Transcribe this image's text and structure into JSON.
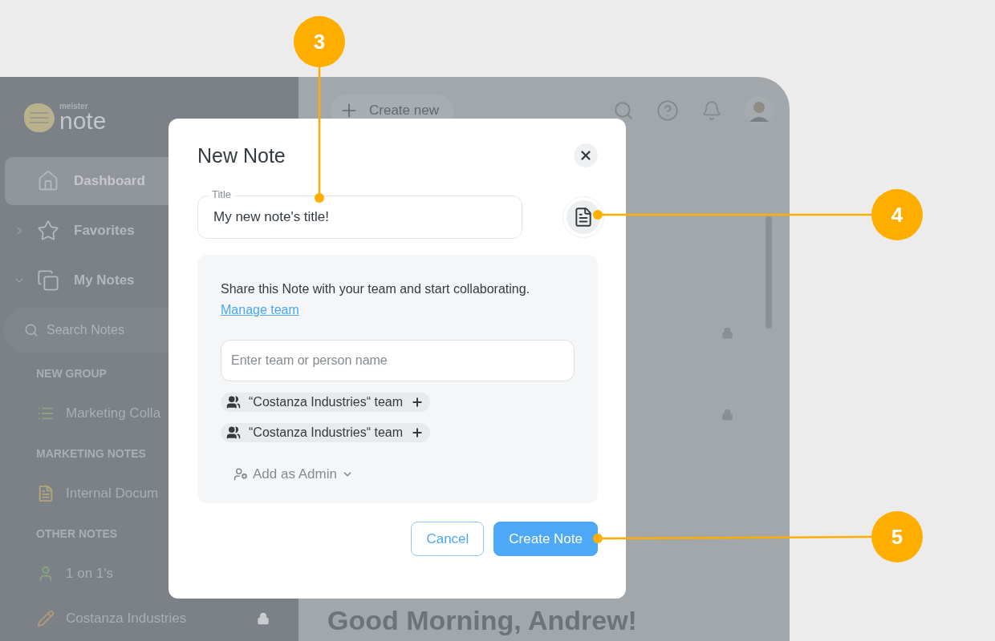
{
  "sidebar": {
    "logo": {
      "small": "meister",
      "large": "note"
    },
    "nav": [
      {
        "label": "Dashboard",
        "selected": true
      },
      {
        "label": "Favorites",
        "selected": false,
        "expanded": false
      },
      {
        "label": "My Notes",
        "selected": false,
        "expanded": true
      }
    ],
    "search": {
      "placeholder": "Search Notes"
    },
    "groups": [
      {
        "title": "NEW GROUP",
        "notes": [
          {
            "kind": "list",
            "label": "Marketing Colla",
            "locked": false
          }
        ]
      },
      {
        "title": "MARKETING NOTES",
        "notes": [
          {
            "kind": "document",
            "label": "Internal Docum",
            "locked": false
          }
        ]
      },
      {
        "title": "OTHER NOTES",
        "notes": [
          {
            "kind": "person",
            "label": "1 on 1's",
            "locked": false
          },
          {
            "kind": "pencil",
            "label": "Costanza Industries",
            "locked": true
          }
        ]
      }
    ]
  },
  "main": {
    "create_button": "Create new",
    "greeting": "Good Morning, Andrew!"
  },
  "modal": {
    "title": "New Note",
    "title_field": {
      "label": "Title",
      "value": "My new note's title!"
    },
    "share_text": "Share this Note with your team and start collaborating.",
    "manage_link": "Manage team",
    "person_field": {
      "placeholder": "Enter team or person name"
    },
    "teams": [
      {
        "label": "“Costanza Industries“ team"
      },
      {
        "label": "“Costanza Industries“ team"
      }
    ],
    "role_select": "Add as Admin",
    "buttons": [
      {
        "kind": "secondary",
        "label": "Cancel"
      },
      {
        "kind": "primary",
        "label": "Create Note"
      }
    ]
  },
  "callouts": [
    {
      "label": "3"
    },
    {
      "label": "4"
    },
    {
      "label": "5"
    }
  ]
}
